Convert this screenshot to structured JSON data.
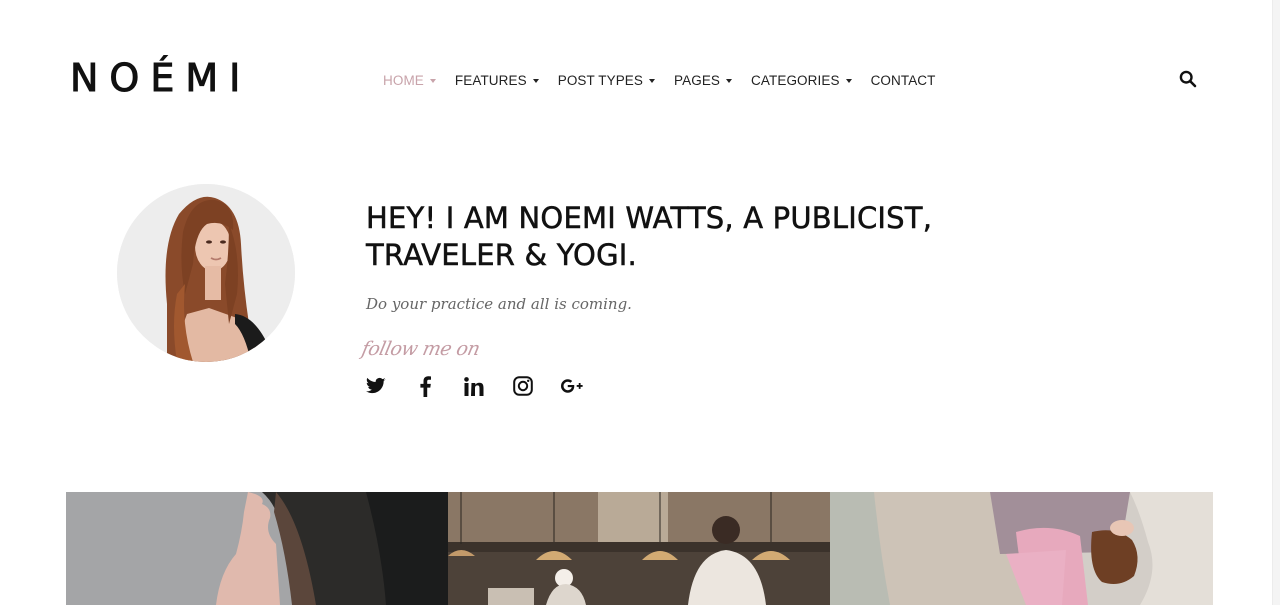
{
  "brand": {
    "logo_text": "NOÉMI"
  },
  "nav": {
    "items": [
      {
        "label": "HOME",
        "has_dropdown": true,
        "active": true
      },
      {
        "label": "FEATURES",
        "has_dropdown": true,
        "active": false
      },
      {
        "label": "POST TYPES",
        "has_dropdown": true,
        "active": false
      },
      {
        "label": "PAGES",
        "has_dropdown": true,
        "active": false
      },
      {
        "label": "CATEGORIES",
        "has_dropdown": true,
        "active": false
      },
      {
        "label": "CONTACT",
        "has_dropdown": false,
        "active": false
      }
    ],
    "active_color": "#c8a3aa",
    "search_icon": "search-icon"
  },
  "intro": {
    "headline": "HEY! I AM NOEMI WATTS, A PUBLICIST, TRAVELER & YOGI.",
    "tagline": "Do your practice and all is coming.",
    "follow_label": "follow me on",
    "follow_color": "#c49ca4"
  },
  "socials": [
    {
      "name": "twitter",
      "icon": "twitter-icon"
    },
    {
      "name": "facebook",
      "icon": "facebook-icon"
    },
    {
      "name": "linkedin",
      "icon": "linkedin-icon"
    },
    {
      "name": "instagram",
      "icon": "instagram-icon"
    },
    {
      "name": "google-plus",
      "icon": "google-plus-icon"
    }
  ],
  "gallery": {
    "tiles": [
      {
        "subject": "woman-profile-photo"
      },
      {
        "subject": "restaurant-kitchen-photo"
      },
      {
        "subject": "girl-with-puppy-photo"
      }
    ]
  }
}
